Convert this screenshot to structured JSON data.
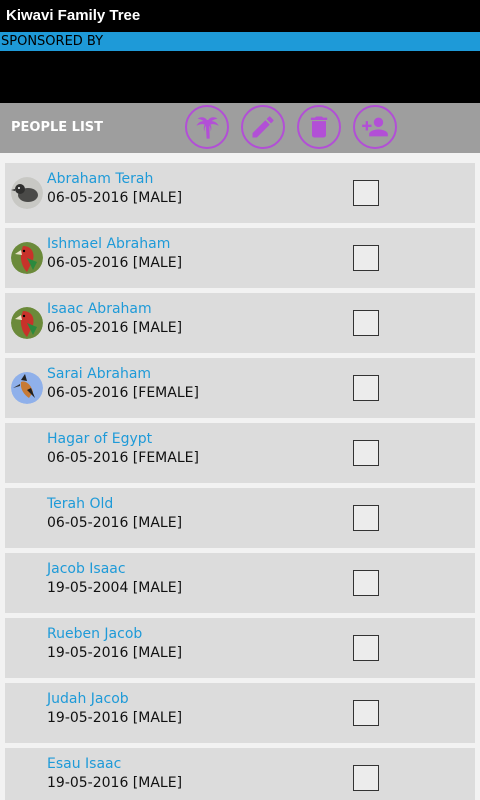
{
  "app": {
    "title": "Kiwavi Family Tree",
    "sponsor_text": "SPONSORED BY"
  },
  "toolbar": {
    "label": "PEOPLE LIST",
    "buttons": [
      {
        "icon": "palm-tree-icon",
        "name": "tree-button"
      },
      {
        "icon": "pencil-icon",
        "name": "edit-button"
      },
      {
        "icon": "trash-icon",
        "name": "delete-button"
      },
      {
        "icon": "add-person-icon",
        "name": "add-person-button"
      }
    ]
  },
  "colors": {
    "accent": "#1e9ad8",
    "icon": "#b24fd6",
    "toolbar": "#9e9e9e",
    "row": "#dcdcdc"
  },
  "people": [
    {
      "name": "Abraham Terah",
      "details": "06-05-2016 [MALE]",
      "avatar": "bird-grey"
    },
    {
      "name": "Ishmael Abraham",
      "details": "06-05-2016 [MALE]",
      "avatar": "parrot"
    },
    {
      "name": "Isaac Abraham",
      "details": "06-05-2016 [MALE]",
      "avatar": "parrot"
    },
    {
      "name": "Sarai Abraham",
      "details": "06-05-2016 [FEMALE]",
      "avatar": "hoopoe"
    },
    {
      "name": "Hagar of Egypt",
      "details": "06-05-2016 [FEMALE]",
      "avatar": ""
    },
    {
      "name": "Terah Old",
      "details": "06-05-2016 [MALE]",
      "avatar": ""
    },
    {
      "name": "Jacob Isaac",
      "details": "19-05-2004 [MALE]",
      "avatar": ""
    },
    {
      "name": "Rueben Jacob",
      "details": "19-05-2016 [MALE]",
      "avatar": ""
    },
    {
      "name": "Judah Jacob",
      "details": "19-05-2016 [MALE]",
      "avatar": ""
    },
    {
      "name": "Esau Isaac",
      "details": "19-05-2016 [MALE]",
      "avatar": ""
    }
  ]
}
